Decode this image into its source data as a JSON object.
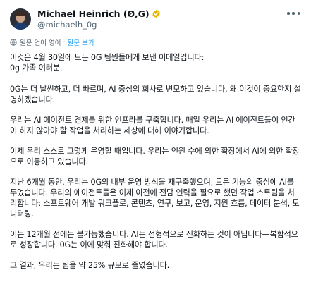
{
  "author": {
    "display_name": "Michael Heinrich (Ø,G)",
    "handle": "@michaelh_0g"
  },
  "translate": {
    "label": "원문 언어 영어",
    "link": "원문 보기"
  },
  "paragraphs": [
    "이것은 4월 30일에 모든 0G 팀원들에게 보낸 이메일입니다:",
    "0g 가족 여러분,",
    "0G는 더 날씬하고, 더 빠르며, AI 중심의 회사로 변모하고 있습니다. 왜 이것이 중요한지 설명하겠습니다.",
    "우리는 AI 에이전트 경제를 위한 인프라를 구축합니다. 매일 우리는 AI 에이전트들이 인간이 하지 않아야 할 작업을 처리하는 세상에 대해 이야기합니다.",
    "이제 우리 스스로 그렇게 운영할 때입니다. 우리는 인원 수에 의한 확장에서 AI에 의한 확장으로 이동하고 있습니다.",
    "지난 6개월 동안, 우리는 0G의 내부 운영 방식을 재구축했으며, 모든 기능의 중심에 AI를 두었습니다. 우리의 에이전트들은 이제 이전에 전담 인력을 필요로 했던 작업 스트림을 처리합니다: 소프트웨어 개발 워크플로, 콘텐츠, 연구, 보고, 운영, 지원 흐름, 데이터 분석, 모니터링.",
    "이는 12개월 전에는 불가능했습니다. AI는 선형적으로 진화하는 것이 아닙니다—복합적으로 성장합니다. 0G는 이에 맞춰 진화해야 합니다.",
    "그 결과, 우리는 팀을 약 25% 규모로 줄였습니다."
  ],
  "colors": {
    "text": "#0f1419",
    "secondary": "#536471",
    "link": "#1d9bf0",
    "verified_gold": "#e8b400"
  },
  "icons": {
    "verified": "verified-badge-icon",
    "more": "more-options-icon",
    "translate": "translate-icon"
  }
}
